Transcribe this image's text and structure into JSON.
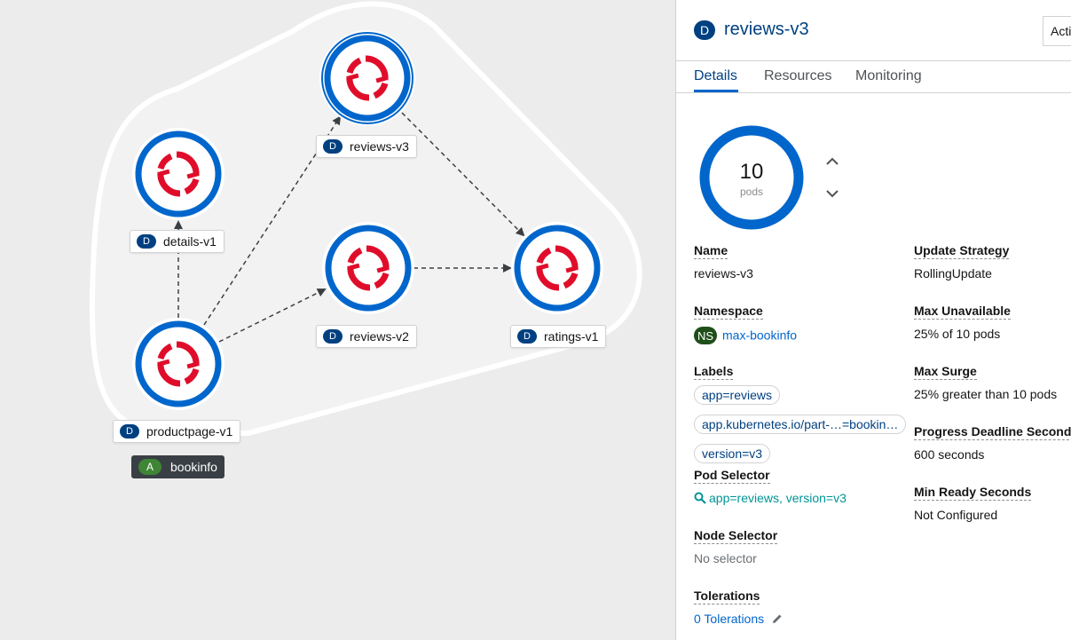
{
  "topology": {
    "nodes": [
      {
        "id": "reviews-v3",
        "label": "reviews-v3",
        "badge": "D",
        "selected": true
      },
      {
        "id": "details-v1",
        "label": "details-v1",
        "badge": "D",
        "selected": false
      },
      {
        "id": "reviews-v2",
        "label": "reviews-v2",
        "badge": "D",
        "selected": false
      },
      {
        "id": "ratings-v1",
        "label": "ratings-v1",
        "badge": "D",
        "selected": false
      },
      {
        "id": "productpage-v1",
        "label": "productpage-v1",
        "badge": "D",
        "selected": false
      }
    ],
    "edges": [
      {
        "from": "productpage-v1",
        "to": "details-v1"
      },
      {
        "from": "productpage-v1",
        "to": "reviews-v3"
      },
      {
        "from": "productpage-v1",
        "to": "reviews-v2"
      },
      {
        "from": "reviews-v3",
        "to": "ratings-v1"
      },
      {
        "from": "reviews-v2",
        "to": "ratings-v1"
      }
    ],
    "group": {
      "badge": "A",
      "label": "bookinfo"
    },
    "colors": {
      "ring": "#0066cc",
      "logo": "#e00d2a",
      "edge": "#3c3f42"
    }
  },
  "panel": {
    "badge": "D",
    "title": "reviews-v3",
    "actions_label": "Actions",
    "tabs": [
      {
        "label": "Details",
        "active": true
      },
      {
        "label": "Resources",
        "active": false
      },
      {
        "label": "Monitoring",
        "active": false
      }
    ],
    "pods": {
      "count": "10",
      "unit": "pods"
    },
    "left_fields": {
      "name": {
        "label": "Name",
        "value": "reviews-v3"
      },
      "namespace": {
        "label": "Namespace",
        "badge": "NS",
        "value": "max-bookinfo"
      },
      "labels": {
        "label": "Labels",
        "items": [
          "app=reviews",
          "app.kubernetes.io/part-…=bookin…",
          "version=v3"
        ]
      },
      "pod_selector": {
        "label": "Pod Selector",
        "value": "app=reviews, version=v3",
        "icon": "search-icon"
      },
      "node_selector": {
        "label": "Node Selector",
        "value": "No selector"
      },
      "tolerations": {
        "label": "Tolerations",
        "value": "0 Tolerations",
        "icon": "pencil-icon"
      }
    },
    "right_fields": {
      "update_strategy": {
        "label": "Update Strategy",
        "value": "RollingUpdate"
      },
      "max_unavailable": {
        "label": "Max Unavailable",
        "value": "25% of 10 pods"
      },
      "max_surge": {
        "label": "Max Surge",
        "value": "25% greater than 10 pods"
      },
      "progress_deadline": {
        "label": "Progress Deadline Seconds",
        "value": "600 seconds"
      },
      "min_ready": {
        "label": "Min Ready Seconds",
        "value": "Not Configured"
      }
    }
  }
}
